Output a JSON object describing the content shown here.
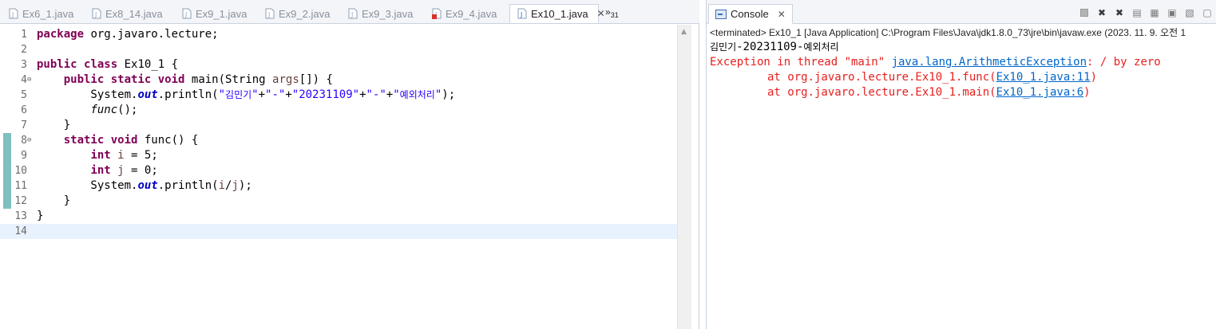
{
  "editor": {
    "tabs": [
      {
        "label": "Ex6_1.java",
        "active": false,
        "error": false
      },
      {
        "label": "Ex8_14.java",
        "active": false,
        "error": false
      },
      {
        "label": "Ex9_1.java",
        "active": false,
        "error": false
      },
      {
        "label": "Ex9_2.java",
        "active": false,
        "error": false
      },
      {
        "label": "Ex9_3.java",
        "active": false,
        "error": false
      },
      {
        "label": "Ex9_4.java",
        "active": false,
        "error": true
      },
      {
        "label": "Ex10_1.java",
        "active": true,
        "error": false
      }
    ],
    "overflow": {
      "chevron": "»",
      "count": "31"
    },
    "lines": [
      {
        "num": "1",
        "tokens": [
          {
            "t": "kw",
            "v": "package"
          },
          {
            "t": "p",
            "v": " org.javaro.lecture;"
          }
        ]
      },
      {
        "num": "2",
        "tokens": []
      },
      {
        "num": "3",
        "tokens": [
          {
            "t": "kw",
            "v": "public"
          },
          {
            "t": "p",
            "v": " "
          },
          {
            "t": "kw",
            "v": "class"
          },
          {
            "t": "p",
            "v": " Ex10_1 {"
          }
        ]
      },
      {
        "num": "4",
        "fold": true,
        "tokens": [
          {
            "t": "p",
            "v": "    "
          },
          {
            "t": "kw",
            "v": "public"
          },
          {
            "t": "p",
            "v": " "
          },
          {
            "t": "kw",
            "v": "static"
          },
          {
            "t": "p",
            "v": " "
          },
          {
            "t": "kw",
            "v": "void"
          },
          {
            "t": "p",
            "v": " main(String "
          },
          {
            "t": "var",
            "v": "args"
          },
          {
            "t": "p",
            "v": "[]) {"
          }
        ]
      },
      {
        "num": "5",
        "tokens": [
          {
            "t": "p",
            "v": "        System."
          },
          {
            "t": "fld",
            "v": "out"
          },
          {
            "t": "p",
            "v": ".println("
          },
          {
            "t": "str",
            "v": "\""
          },
          {
            "t": "strk",
            "v": "김민기"
          },
          {
            "t": "str",
            "v": "\""
          },
          {
            "t": "p",
            "v": "+"
          },
          {
            "t": "str",
            "v": "\"-\""
          },
          {
            "t": "p",
            "v": "+"
          },
          {
            "t": "str",
            "v": "\"20231109\""
          },
          {
            "t": "p",
            "v": "+"
          },
          {
            "t": "str",
            "v": "\"-\""
          },
          {
            "t": "p",
            "v": "+"
          },
          {
            "t": "str",
            "v": "\""
          },
          {
            "t": "strk",
            "v": "예외처리"
          },
          {
            "t": "str",
            "v": "\""
          },
          {
            "t": "p",
            "v": ");"
          }
        ]
      },
      {
        "num": "6",
        "tokens": [
          {
            "t": "p",
            "v": "        "
          },
          {
            "t": "mth",
            "v": "func"
          },
          {
            "t": "p",
            "v": "();"
          }
        ]
      },
      {
        "num": "7",
        "tokens": [
          {
            "t": "p",
            "v": "    }"
          }
        ]
      },
      {
        "num": "8",
        "fold": true,
        "mark": true,
        "tokens": [
          {
            "t": "p",
            "v": "    "
          },
          {
            "t": "kw",
            "v": "static"
          },
          {
            "t": "p",
            "v": " "
          },
          {
            "t": "kw",
            "v": "void"
          },
          {
            "t": "p",
            "v": " func() {"
          }
        ]
      },
      {
        "num": "9",
        "mark": true,
        "tokens": [
          {
            "t": "p",
            "v": "        "
          },
          {
            "t": "kw",
            "v": "int"
          },
          {
            "t": "p",
            "v": " "
          },
          {
            "t": "var",
            "v": "i"
          },
          {
            "t": "p",
            "v": " = 5;"
          }
        ]
      },
      {
        "num": "10",
        "mark": true,
        "tokens": [
          {
            "t": "p",
            "v": "        "
          },
          {
            "t": "kw",
            "v": "int"
          },
          {
            "t": "p",
            "v": " "
          },
          {
            "t": "var",
            "v": "j"
          },
          {
            "t": "p",
            "v": " = 0;"
          }
        ]
      },
      {
        "num": "11",
        "mark": true,
        "tokens": [
          {
            "t": "p",
            "v": "        System."
          },
          {
            "t": "fld",
            "v": "out"
          },
          {
            "t": "p",
            "v": ".println("
          },
          {
            "t": "var",
            "v": "i"
          },
          {
            "t": "p",
            "v": "/"
          },
          {
            "t": "var",
            "v": "j"
          },
          {
            "t": "p",
            "v": ");"
          }
        ]
      },
      {
        "num": "12",
        "mark": true,
        "tokens": [
          {
            "t": "p",
            "v": "    }"
          }
        ]
      },
      {
        "num": "13",
        "tokens": [
          {
            "t": "p",
            "v": "}"
          }
        ]
      },
      {
        "num": "14",
        "current": true,
        "tokens": []
      }
    ]
  },
  "console": {
    "tab_label": "Console",
    "status": "<terminated> Ex10_1 [Java Application] C:\\Program Files\\Java\\jdk1.8.0_73\\jre\\bin\\javaw.exe (2023. 11. 9. 오전 1",
    "output": {
      "name": "김민기",
      "rest": "-20231109-",
      "tail": "예외처리"
    },
    "exception": {
      "prefix": "Exception in thread \"main\" ",
      "class_link": "java.lang.ArithmeticException",
      "message": ": / by zero"
    },
    "stack": [
      {
        "at": "at org.javaro.lecture.Ex10_1.func(",
        "link": "Ex10_1.java:11",
        "close": ")"
      },
      {
        "at": "at org.javaro.lecture.Ex10_1.main(",
        "link": "Ex10_1.java:6",
        "close": ")"
      }
    ]
  },
  "colors": {
    "keyword": "#7f0055",
    "string": "#2a00ff",
    "field": "#0000c0",
    "error": "#e62020",
    "link": "#0066cc",
    "change_marker": "#7fbfbf",
    "current_line": "#e8f2fe"
  }
}
